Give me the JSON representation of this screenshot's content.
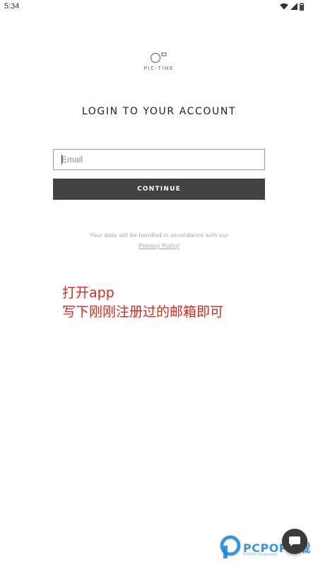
{
  "status_bar": {
    "time": "5:34",
    "icons": [
      "wifi-icon",
      "signal-icon",
      "battery-icon"
    ]
  },
  "logo": {
    "brand": "PIC-TIME"
  },
  "login": {
    "title": "LOGIN TO YOUR ACCOUNT",
    "email_placeholder": "Email",
    "email_value": "",
    "continue_label": "CONTINUE",
    "privacy_text": "Your data will be handled in accordance with our",
    "privacy_link": "Privacy Policy"
  },
  "annotation": {
    "line1": "打开app",
    "line2": "写下刚刚注册过的邮箱即可"
  },
  "chat": {
    "icon": "chat-bubble-icon"
  },
  "watermark": {
    "brand": "PCPOP下载",
    "sub": "PCPOP Download"
  },
  "colors": {
    "button_bg": "#424242",
    "annotation": "#d9291c",
    "watermark": "#1c82d6"
  }
}
